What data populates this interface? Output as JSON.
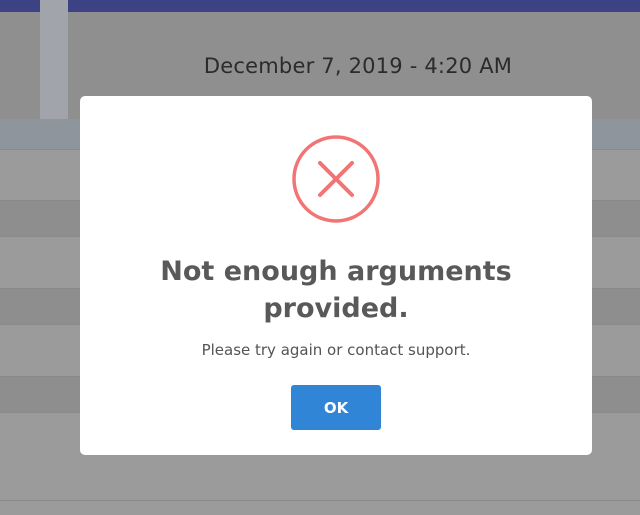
{
  "background": {
    "datetime": "December 7, 2019 - 4:20 AM"
  },
  "modal": {
    "icon": "error-x-icon",
    "icon_color": "#f27474",
    "title": "Not enough arguments provided.",
    "message": "Please try again or contact support.",
    "confirm_label": "OK",
    "confirm_color": "#3085d6"
  }
}
